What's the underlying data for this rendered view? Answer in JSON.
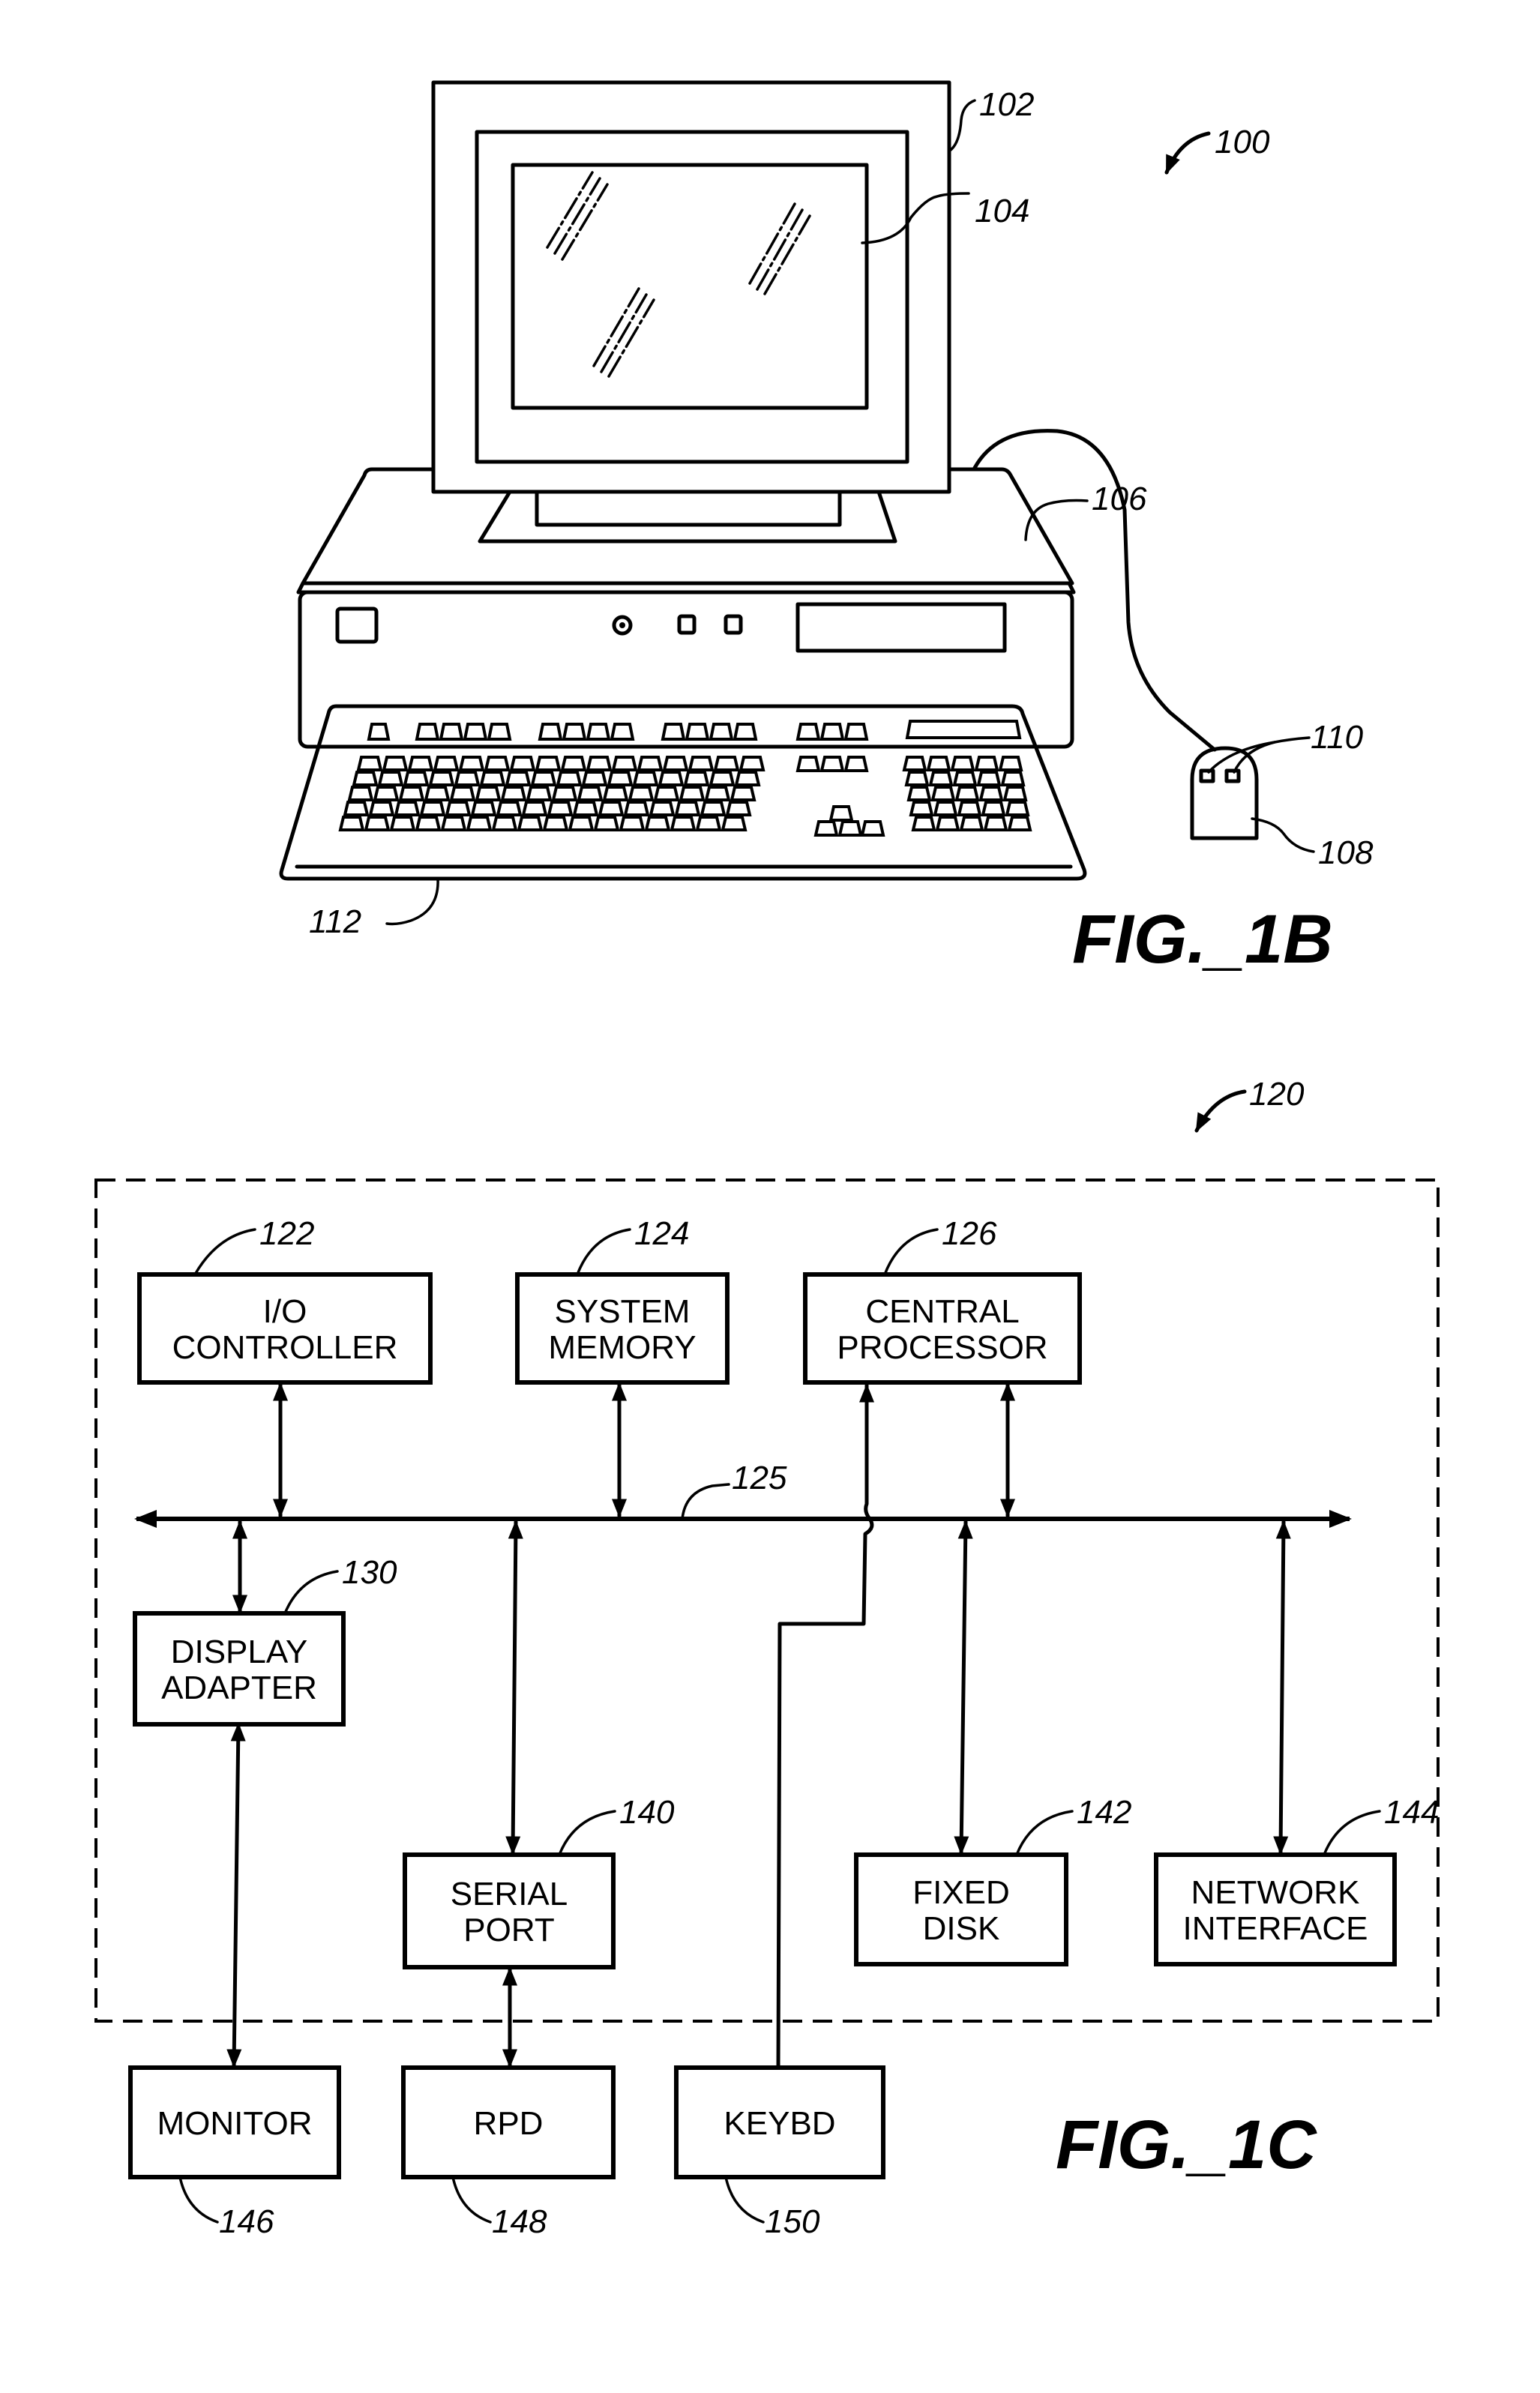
{
  "fig1b": {
    "caption": "FIG._1B",
    "refs": {
      "system": "100",
      "monitor": "102",
      "screen": "104",
      "cabinet": "106",
      "mouse": "108",
      "mouse_buttons": "110",
      "keyboard": "112"
    }
  },
  "fig1c": {
    "caption": "FIG._1C",
    "system_ref": "120",
    "bus_ref": "125",
    "blocks": [
      {
        "id": "io",
        "lines": [
          "I/O",
          "CONTROLLER"
        ],
        "ref": "122"
      },
      {
        "id": "memory",
        "lines": [
          "SYSTEM",
          "MEMORY"
        ],
        "ref": "124"
      },
      {
        "id": "cpu",
        "lines": [
          "CENTRAL",
          "PROCESSOR"
        ],
        "ref": "126"
      },
      {
        "id": "display",
        "lines": [
          "DISPLAY",
          "ADAPTER"
        ],
        "ref": "130"
      },
      {
        "id": "serial",
        "lines": [
          "SERIAL",
          "PORT"
        ],
        "ref": "140"
      },
      {
        "id": "disk",
        "lines": [
          "FIXED",
          "DISK"
        ],
        "ref": "142"
      },
      {
        "id": "network",
        "lines": [
          "NETWORK",
          "INTERFACE"
        ],
        "ref": "144"
      },
      {
        "id": "monitor",
        "lines": [
          "MONITOR"
        ],
        "ref": "146"
      },
      {
        "id": "rpd",
        "lines": [
          "RPD"
        ],
        "ref": "148"
      },
      {
        "id": "keybd",
        "lines": [
          "KEYBD"
        ],
        "ref": "150"
      }
    ]
  }
}
